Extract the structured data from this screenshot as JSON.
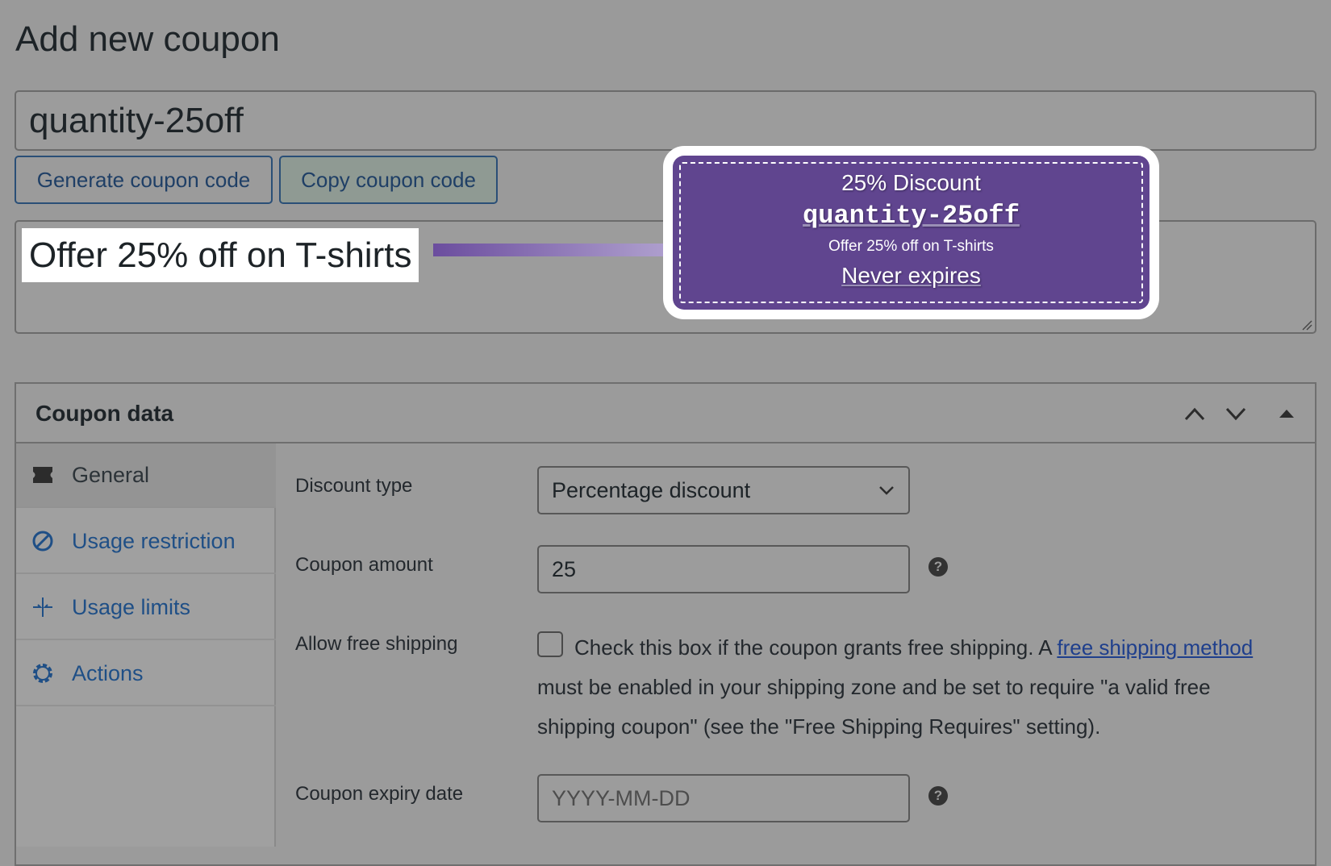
{
  "page": {
    "title": "Add new coupon"
  },
  "coupon_code": {
    "value": "quantity-25off"
  },
  "buttons": {
    "generate_label": "Generate coupon code",
    "copy_label": "Copy coupon code"
  },
  "description": {
    "value": "Offer 25% off on T-shirts"
  },
  "coupon_preview": {
    "amount": "25% Discount",
    "code": "quantity-25off",
    "description": "Offer 25% off on T-shirts",
    "expiry": "Never expires",
    "bg_color": "#60458f"
  },
  "coupon_data": {
    "title": "Coupon data",
    "tabs": [
      {
        "label": "General",
        "icon": "ticket-icon",
        "active": true
      },
      {
        "label": "Usage restriction",
        "icon": "restriction-icon",
        "active": false
      },
      {
        "label": "Usage limits",
        "icon": "limits-icon",
        "active": false
      },
      {
        "label": "Actions",
        "icon": "gear-icon",
        "active": false
      }
    ],
    "fields": {
      "discount_type": {
        "label": "Discount type",
        "value": "Percentage discount"
      },
      "coupon_amount": {
        "label": "Coupon amount",
        "value": "25"
      },
      "free_shipping": {
        "label": "Allow free shipping",
        "text_before": "Check this box if the coupon grants free shipping. A ",
        "link_text": "free shipping method",
        "text_after": " must be enabled in your shipping zone and be set to require \"a valid free shipping coupon\" (see the \"Free Shipping Requires\" setting)."
      },
      "expiry_date": {
        "label": "Coupon expiry date",
        "placeholder": "YYYY-MM-DD"
      }
    }
  }
}
